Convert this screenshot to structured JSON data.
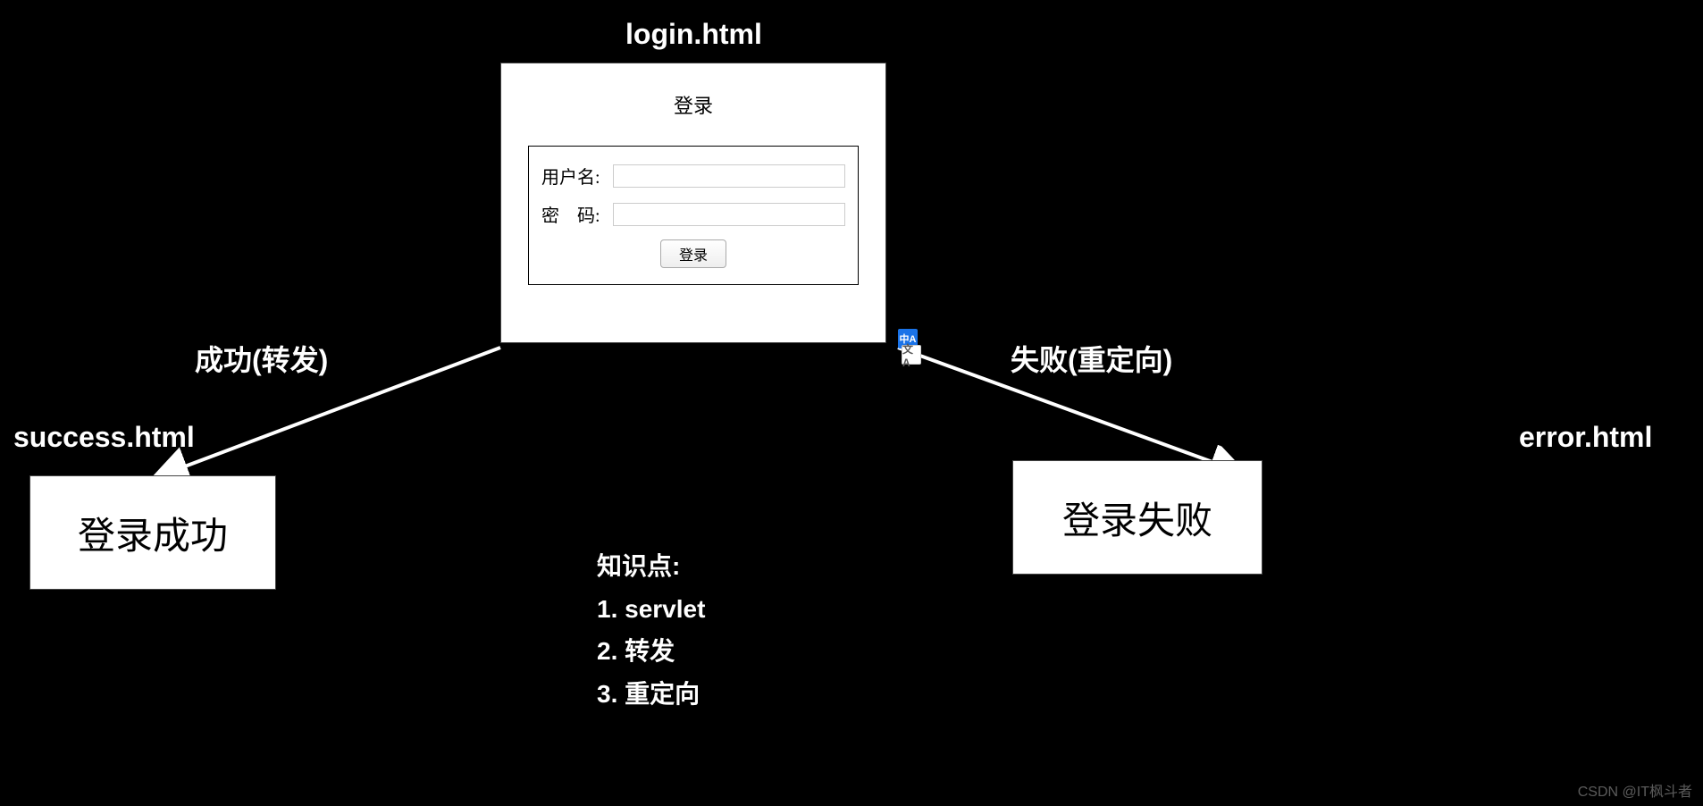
{
  "title_login": "login.html",
  "title_success": "success.html",
  "title_error": "error.html",
  "login_panel": {
    "heading": "登录",
    "username_label": "用户名:",
    "password_label_first": "密",
    "password_label_rest": "码:",
    "submit_label": "登录"
  },
  "arrow_labels": {
    "success": "成功(转发)",
    "error": "失败(重定向)"
  },
  "success_text": "登录成功",
  "error_text": "登录失败",
  "knowledge": {
    "heading": "知识点:",
    "items": [
      "1. servlet",
      "2. 转发",
      "3. 重定向"
    ]
  },
  "translate_icon": {
    "top": "中A",
    "bottom": "文A"
  },
  "watermark": "CSDN @IT枫斗者"
}
